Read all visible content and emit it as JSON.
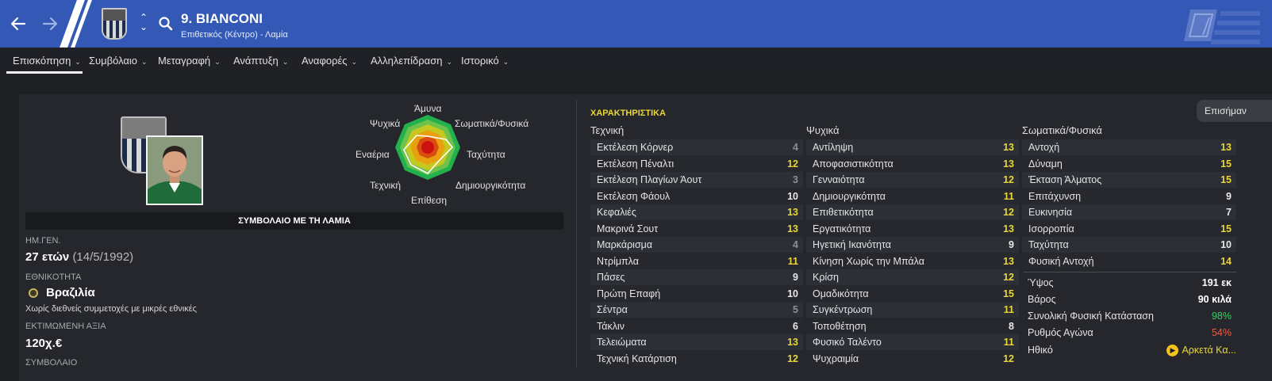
{
  "header": {
    "title": "9. BIANCONI",
    "subtitle": "Επιθετικός (Κέντρο) - Λαμία",
    "icons": [
      "back-arrow-icon",
      "forward-arrow-icon",
      "club-crest",
      "up-down-chevron-icon",
      "search-icon",
      "logo-icon"
    ]
  },
  "tabs": [
    {
      "label": "Επισκόπηση"
    },
    {
      "label": "Συμβόλαιο"
    },
    {
      "label": "Μεταγραφή"
    },
    {
      "label": "Ανάπτυξη"
    },
    {
      "label": "Αναφορές"
    },
    {
      "label": "Αλληλεπίδραση"
    },
    {
      "label": "Ιστορικό"
    }
  ],
  "radar": {
    "labels": {
      "defence": "Άμυνα",
      "physical": "Σωματικά/Φυσικά",
      "speed": "Ταχύτητα",
      "creativity": "Δημιουργικότητα",
      "attack": "Επίθεση",
      "technique": "Τεχνική",
      "aerial": "Εναέρια",
      "mental": "Ψυχικά"
    }
  },
  "profile": {
    "contract_banner": "ΣΥΜΒΟΛΑΙΟ ΜΕ ΤΗ ΛΑΜΙΑ",
    "dob_label": "ΗΜ.ΓΕΝ.",
    "age": "27 ετών",
    "dob": "(14/5/1992)",
    "nationality_label": "ΕΘΝΙΚΟΤΗΤΑ",
    "nationality": "Βραζιλία",
    "intl_note": "Χωρίς διεθνείς συμμετοχές με μικρές εθνικές",
    "value_label": "ΕΚΤΙΜΩΜΕΝΗ ΑΞΙΑ",
    "value": "120χ.€",
    "contract_label": "ΣΥΜΒΟΛΑΙΟ"
  },
  "attributes": {
    "title": "ΧΑΡΑΚΤΗΡΙΣΤΙΚΑ",
    "important_button": "Επισήμαν",
    "columns": [
      {
        "header": "Τεχνική",
        "rows": [
          {
            "name": "Εκτέλεση Κόρνερ",
            "value": "4"
          },
          {
            "name": "Εκτέλεση Πέναλτι",
            "value": "12"
          },
          {
            "name": "Εκτέλεση Πλαγίων Άουτ",
            "value": "3"
          },
          {
            "name": "Εκτέλεση Φάουλ",
            "value": "10"
          },
          {
            "name": "Κεφαλιές",
            "value": "13"
          },
          {
            "name": "Μακρινά Σουτ",
            "value": "13"
          },
          {
            "name": "Μαρκάρισμα",
            "value": "4"
          },
          {
            "name": "Ντρίμπλα",
            "value": "11"
          },
          {
            "name": "Πάσες",
            "value": "9"
          },
          {
            "name": "Πρώτη Επαφή",
            "value": "10"
          },
          {
            "name": "Σέντρα",
            "value": "5"
          },
          {
            "name": "Τάκλιν",
            "value": "6"
          },
          {
            "name": "Τελειώματα",
            "value": "13"
          },
          {
            "name": "Τεχνική Κατάρτιση",
            "value": "12"
          }
        ]
      },
      {
        "header": "Ψυχικά",
        "rows": [
          {
            "name": "Αντίληψη",
            "value": "13"
          },
          {
            "name": "Αποφασιστικότητα",
            "value": "13"
          },
          {
            "name": "Γενναιότητα",
            "value": "12"
          },
          {
            "name": "Δημιουργικότητα",
            "value": "11"
          },
          {
            "name": "Επιθετικότητα",
            "value": "12"
          },
          {
            "name": "Εργατικότητα",
            "value": "13"
          },
          {
            "name": "Ηγετική Ικανότητα",
            "value": "9"
          },
          {
            "name": "Κίνηση Χωρίς την Μπάλα",
            "value": "13"
          },
          {
            "name": "Κρίση",
            "value": "12"
          },
          {
            "name": "Ομαδικότητα",
            "value": "15"
          },
          {
            "name": "Συγκέντρωση",
            "value": "11"
          },
          {
            "name": "Τοποθέτηση",
            "value": "8"
          },
          {
            "name": "Φυσικό Ταλέντο",
            "value": "11"
          },
          {
            "name": "Ψυχραιμία",
            "value": "12"
          }
        ]
      },
      {
        "header": "Σωματικά/Φυσικά",
        "rows": [
          {
            "name": "Αντοχή",
            "value": "13"
          },
          {
            "name": "Δύναμη",
            "value": "15"
          },
          {
            "name": "Έκταση Άλματος",
            "value": "15"
          },
          {
            "name": "Επιτάχυνση",
            "value": "9"
          },
          {
            "name": "Ευκινησία",
            "value": "7"
          },
          {
            "name": "Ισορροπία",
            "value": "15"
          },
          {
            "name": "Ταχύτητα",
            "value": "10"
          },
          {
            "name": "Φυσική Αντοχή",
            "value": "14"
          }
        ]
      }
    ],
    "info": [
      {
        "name": "Ύψος",
        "value": "191 εκ"
      },
      {
        "name": "Βάρος",
        "value": "90 κιλά"
      },
      {
        "name": "Συνολική Φυσική Κατάσταση",
        "value": "98%"
      },
      {
        "name": "Ρυθμός Αγώνα",
        "value": "54%"
      },
      {
        "name": "Ηθικό",
        "value": "Αρκετά Κα..."
      }
    ]
  },
  "colors": {
    "header_blue": "#3358b5",
    "value_white": "#e8e8e8",
    "value_grey": "#8f8f8f",
    "value_yellow": "#e8d63b",
    "good_green": "#3dcb63",
    "warn_red": "#e8604c"
  }
}
